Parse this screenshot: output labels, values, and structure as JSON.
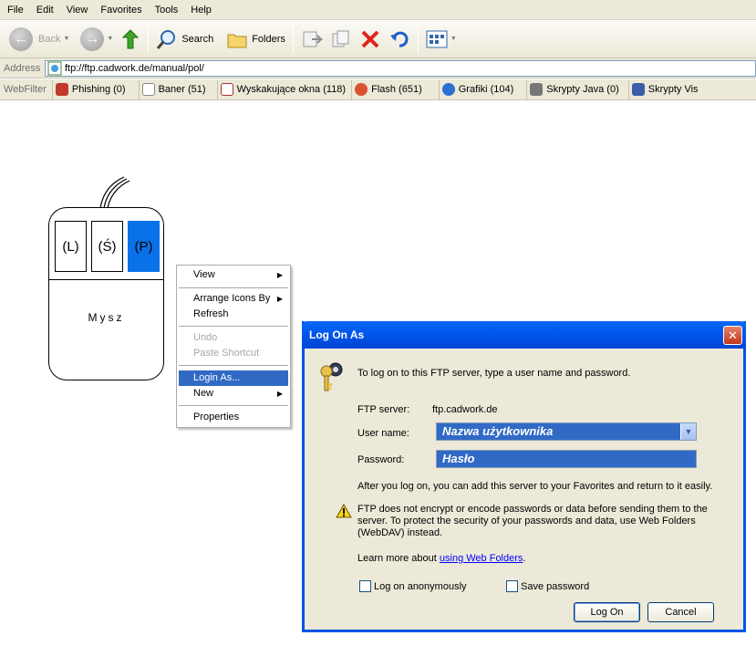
{
  "menubar": {
    "items": [
      "File",
      "Edit",
      "View",
      "Favorites",
      "Tools",
      "Help"
    ]
  },
  "toolbar": {
    "back": "Back",
    "search": "Search",
    "folders": "Folders"
  },
  "address": {
    "label": "Address",
    "url": "ftp://ftp.cadwork.de/manual/pol/"
  },
  "webfilter": {
    "label": "WebFilter",
    "items": [
      "Phishing (0)",
      "Baner (51)",
      "Wyskakujące okna (118)",
      "Flash (651)",
      "Grafiki (104)",
      "Skrypty Java (0)",
      "Skrypty Vis"
    ]
  },
  "mouse": {
    "left": "(L)",
    "middle": "(Ś)",
    "right": "(P)",
    "label": "Mysz"
  },
  "context_menu": {
    "items": [
      "View",
      "Arrange Icons By",
      "Refresh",
      "Undo",
      "Paste Shortcut",
      "Login As...",
      "New",
      "Properties"
    ]
  },
  "dialog": {
    "title": "Log On As",
    "intro": "To log on to this FTP server, type a user name and password.",
    "server_label": "FTP server:",
    "server_value": "ftp.cadwork.de",
    "username_label": "User name:",
    "username_value": "Nazwa użytkownika",
    "password_label": "Password:",
    "password_value": "Hasło",
    "after_text": "After you log on, you can add this server to your Favorites and return to it easily.",
    "warning_line1": "FTP does not encrypt or encode passwords or data before sending them to the",
    "warning_line2": "server.  To protect the security of your passwords and data, use Web Folders",
    "warning_line3": "(WebDAV) instead.",
    "learn_prefix": "Learn more about ",
    "learn_link": "using Web Folders",
    "learn_suffix": ".",
    "anon_label": "Log on anonymously",
    "save_label": "Save password",
    "logon_btn": "Log On",
    "cancel_btn": "Cancel"
  },
  "colors": {
    "accent": "#316ac5",
    "mouse_active": "#0a72e8",
    "title_bar": "#0058ee"
  },
  "icons": [
    "back-arrow-icon",
    "forward-arrow-icon",
    "up-folder-icon",
    "search-icon",
    "folders-icon",
    "move-to-icon",
    "copy-to-icon",
    "delete-icon",
    "undo-icon",
    "views-icon",
    "keys-icon",
    "warning-icon",
    "ftp-icon",
    "shield-icon"
  ]
}
